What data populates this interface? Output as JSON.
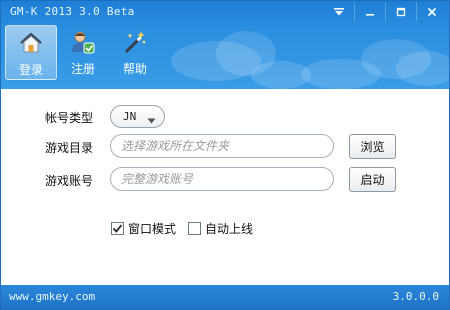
{
  "window": {
    "title": "GM-K 2013 3.0 Beta"
  },
  "title_controls": {
    "menu_icon": "menu-down-icon",
    "minimize_icon": "minimize-icon",
    "maximize_icon": "maximize-icon",
    "close_icon": "close-icon"
  },
  "toolbar": {
    "items": [
      {
        "label": "登录",
        "icon": "home-icon",
        "active": true
      },
      {
        "label": "注册",
        "icon": "user-check-icon",
        "active": false
      },
      {
        "label": "帮助",
        "icon": "magic-wand-icon",
        "active": false
      }
    ]
  },
  "form": {
    "account_type": {
      "label": "帐号类型",
      "value": "JN"
    },
    "game_dir": {
      "label": "游戏目录",
      "placeholder": "选择游戏所在文件夹",
      "button": "浏览"
    },
    "game_account": {
      "label": "游戏账号",
      "placeholder": "完整游戏账号",
      "button": "启动"
    }
  },
  "options": {
    "window_mode": {
      "label": "窗口模式",
      "checked": true
    },
    "auto_online": {
      "label": "自动上线",
      "checked": false
    }
  },
  "footer": {
    "site": "www.gmkey.com",
    "version": "3.0.0.0"
  },
  "colors": {
    "header_blue": "#2b8fe0",
    "footer_blue": "#1f74c7"
  }
}
